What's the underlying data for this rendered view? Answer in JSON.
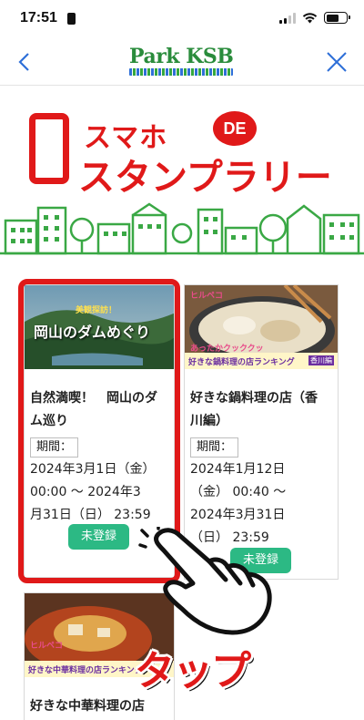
{
  "status_bar": {
    "time": "17:51"
  },
  "header": {
    "logo_text_1": "Park",
    "logo_text_2": "KSB"
  },
  "banner": {
    "line1": "スマホ",
    "de": "DE",
    "line2": "スタンプラリー"
  },
  "cards": [
    {
      "thumb_caption_top": "美観探訪！",
      "thumb_caption": "岡山のダムめぐり",
      "title_line1": "自然満喫！　岡山のダ",
      "title_line2": "ム巡り",
      "period_label": "期間：",
      "period_line1": "2024年3月1日（金）",
      "period_line2": "00:00 ～ 2024年3",
      "period_line3": "月31日（日） 23:59",
      "status": "未登録"
    },
    {
      "thumb_caption_top": "あったかクッククッ",
      "thumb_brand": "ヒルペコ",
      "thumb_caption": "好きな鍋料理の店ランキング",
      "thumb_tag": "香川編",
      "title_line1": "好きな鍋料理の店（香",
      "title_line2": "川編）",
      "period_label": "期間：",
      "period_line1": "2024年1月12日",
      "period_line2": "（金） 00:40 ～",
      "period_line3": "2024年3月31日",
      "period_line4": "（日） 23:59",
      "status": "未登録"
    },
    {
      "thumb_brand": "ヒルペコ",
      "thumb_caption": "好きな中華料理の店ランキング",
      "title_line1": "好きな中華料理の店"
    }
  ],
  "overlay": {
    "tap_label": "タップ"
  },
  "colors": {
    "brand_red": "#e01919",
    "button_green": "#2cb984",
    "logo_green": "#2a8c3c"
  }
}
